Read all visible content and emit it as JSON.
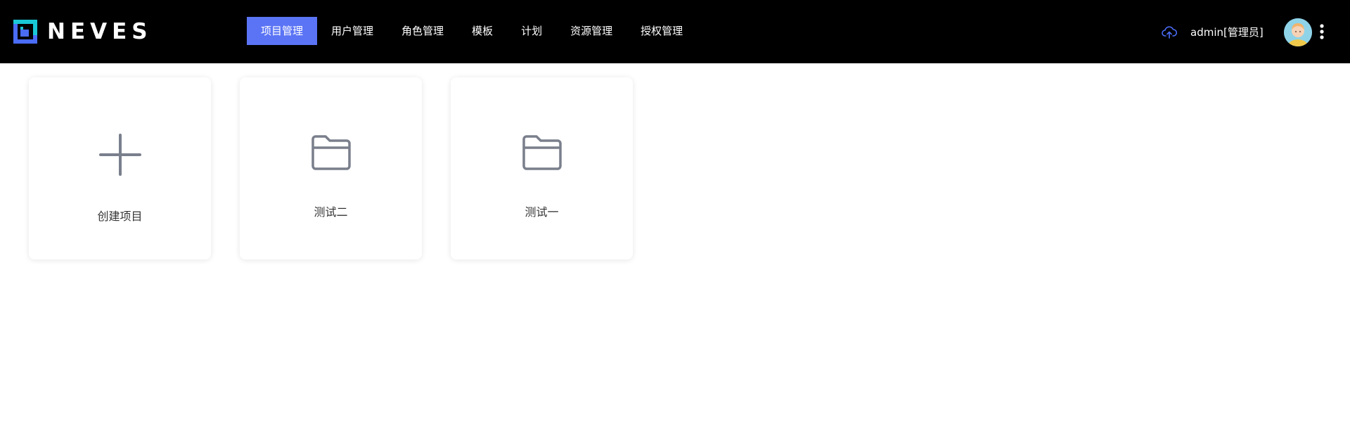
{
  "brand": {
    "name": "NEVES",
    "accent": "#5b74f5",
    "logo_cyan": "#19c8d6",
    "logo_blue": "#4a6cf7"
  },
  "header": {
    "background": "#000000",
    "nav": [
      {
        "label": "项目管理",
        "active": true
      },
      {
        "label": "用户管理",
        "active": false
      },
      {
        "label": "角色管理",
        "active": false
      },
      {
        "label": "模板",
        "active": false
      },
      {
        "label": "计划",
        "active": false
      },
      {
        "label": "资源管理",
        "active": false
      },
      {
        "label": "授权管理",
        "active": false
      }
    ],
    "user_label": "admin[管理员]",
    "icons": {
      "cloud": "cloud-upload-icon",
      "avatar": "user-avatar",
      "more": "more-vertical-icon"
    }
  },
  "main": {
    "cards": [
      {
        "label": "创建项目",
        "icon": "plus-icon"
      },
      {
        "label": "测试二",
        "icon": "folder-icon"
      },
      {
        "label": "测试一",
        "icon": "folder-icon"
      }
    ],
    "icon_color": "#7a7f8c"
  }
}
